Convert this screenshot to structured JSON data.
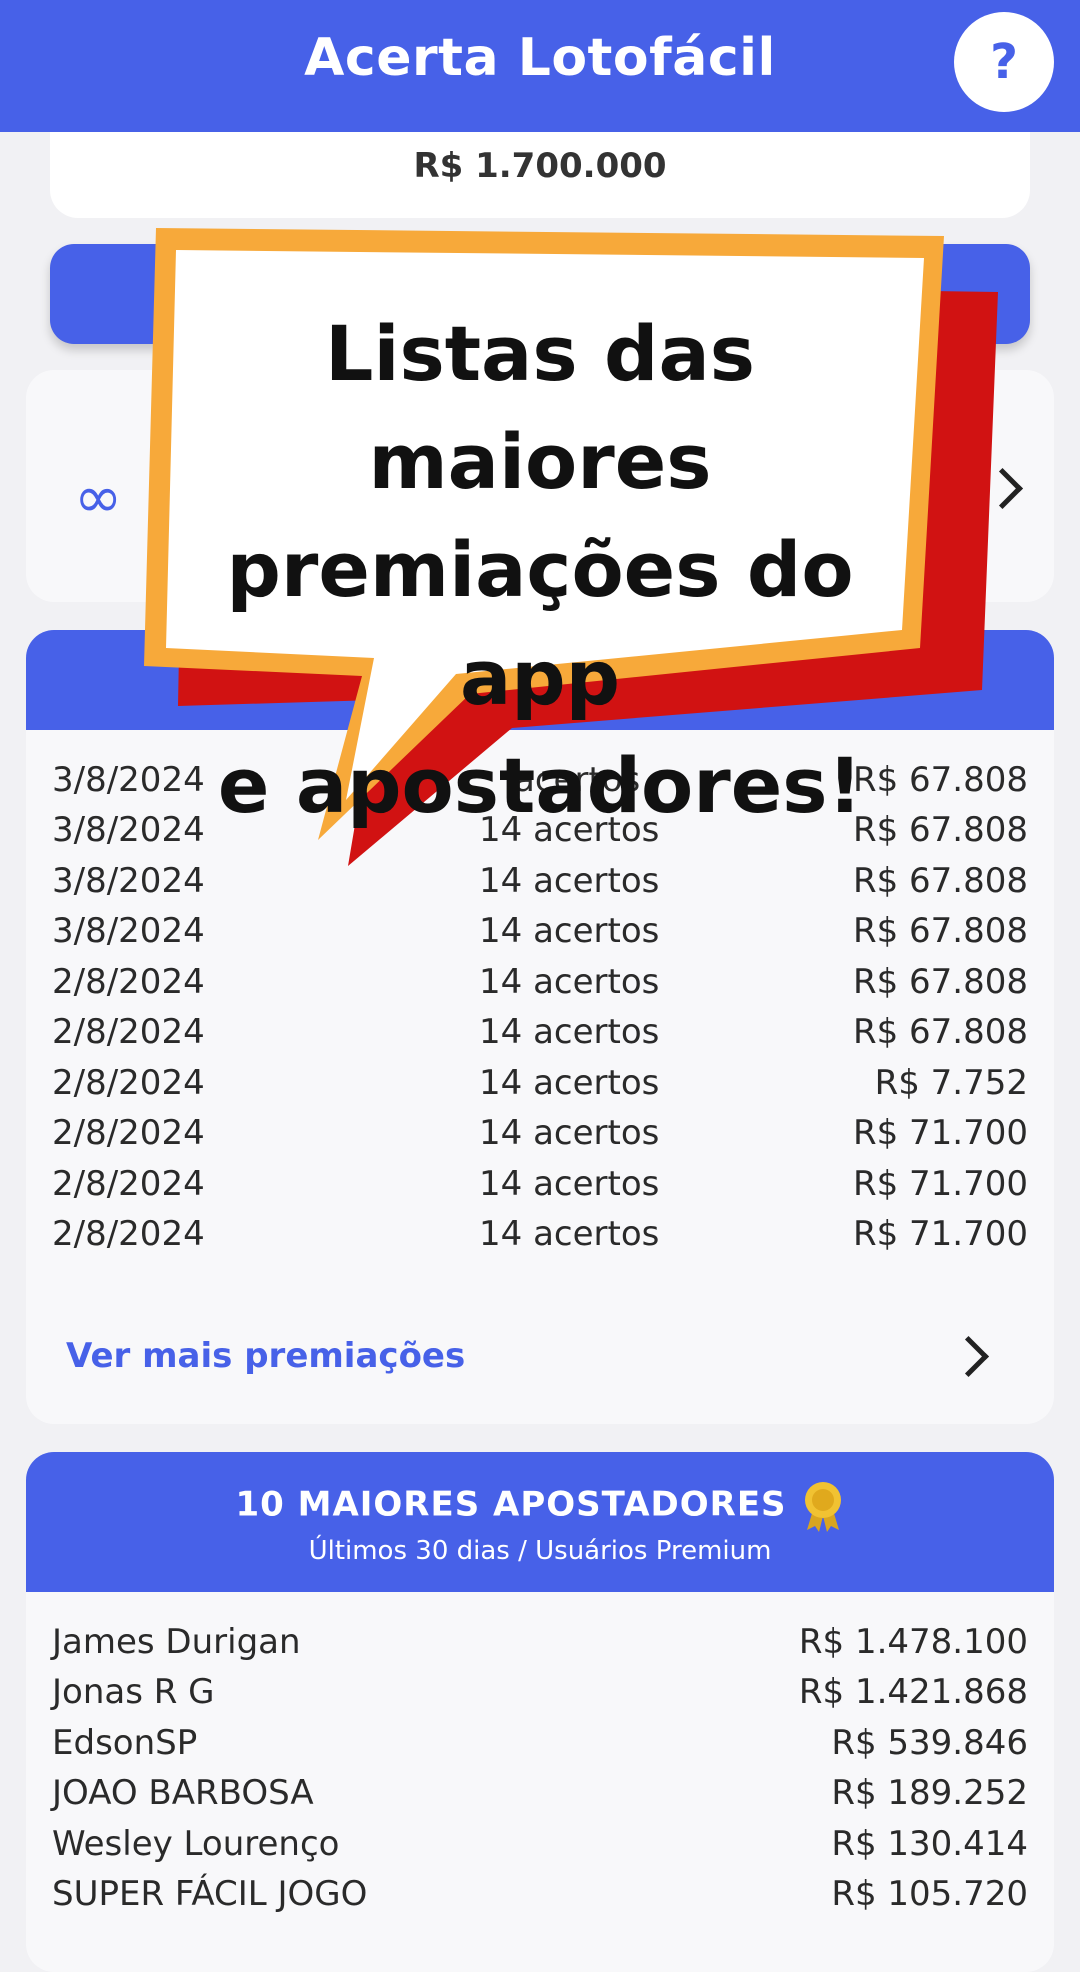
{
  "header": {
    "title": "Acerta Lotofácil",
    "help_label": "?"
  },
  "prize_card": {
    "amount": "R$ 1.700.000"
  },
  "promo_bubble": {
    "lines": [
      "Listas das maiores",
      "premiações do app",
      "e apostadores!"
    ]
  },
  "winners": {
    "rows": [
      {
        "date": "3/8/2024",
        "hits": "acertos",
        "prize": "R$ 67.808"
      },
      {
        "date": "3/8/2024",
        "hits": "14 acertos",
        "prize": "R$ 67.808"
      },
      {
        "date": "3/8/2024",
        "hits": "14 acertos",
        "prize": "R$ 67.808"
      },
      {
        "date": "3/8/2024",
        "hits": "14 acertos",
        "prize": "R$ 67.808"
      },
      {
        "date": "2/8/2024",
        "hits": "14 acertos",
        "prize": "R$ 67.808"
      },
      {
        "date": "2/8/2024",
        "hits": "14 acertos",
        "prize": "R$ 67.808"
      },
      {
        "date": "2/8/2024",
        "hits": "14 acertos",
        "prize": "R$ 7.752"
      },
      {
        "date": "2/8/2024",
        "hits": "14 acertos",
        "prize": "R$ 71.700"
      },
      {
        "date": "2/8/2024",
        "hits": "14 acertos",
        "prize": "R$ 71.700"
      },
      {
        "date": "2/8/2024",
        "hits": "14 acertos",
        "prize": "R$ 71.700"
      }
    ],
    "more_label": "Ver mais premiações"
  },
  "bettors": {
    "title": "10 MAIORES APOSTADORES",
    "subtitle": "Últimos 30 dias / Usuários Premium",
    "rows": [
      {
        "name": "James Durigan",
        "amount": "R$ 1.478.100"
      },
      {
        "name": "Jonas R G",
        "amount": "R$ 1.421.868"
      },
      {
        "name": "EdsonSP",
        "amount": "R$ 539.846"
      },
      {
        "name": "JOAO BARBOSA",
        "amount": "R$ 189.252"
      },
      {
        "name": "Wesley Lourenço",
        "amount": "R$ 130.414"
      },
      {
        "name": "SUPER FÁCIL JOGO",
        "amount": "R$ 105.720"
      }
    ]
  },
  "icons": {
    "help": "question-mark-icon",
    "infinity": "infinity-icon",
    "chevron": "chevron-right-icon",
    "medal": "medal-icon"
  },
  "colors": {
    "primary": "#4761e8",
    "bubble_orange": "#f7a93a",
    "bubble_red": "#d11212"
  }
}
